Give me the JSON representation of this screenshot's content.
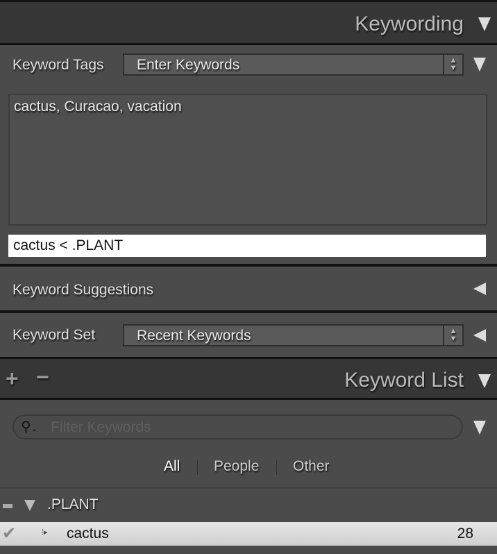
{
  "keywording": {
    "title": "Keywording"
  },
  "keyword_tags": {
    "label": "Keyword Tags",
    "mode": "Enter Keywords",
    "keywords_text": "cactus, Curacao, vacation",
    "input_value": "cactus < .PLANT"
  },
  "keyword_suggestions": {
    "label": "Keyword Suggestions"
  },
  "keyword_set": {
    "label": "Keyword Set",
    "value": "Recent Keywords"
  },
  "keyword_list": {
    "title": "Keyword List",
    "add": "+",
    "remove": "−",
    "filter_placeholder": "Filter Keywords",
    "tabs": [
      "All",
      "People",
      "Other"
    ],
    "parent": {
      "name": ".PLANT"
    },
    "items": [
      {
        "name": "cactus",
        "count": "28",
        "checked": true
      }
    ]
  }
}
